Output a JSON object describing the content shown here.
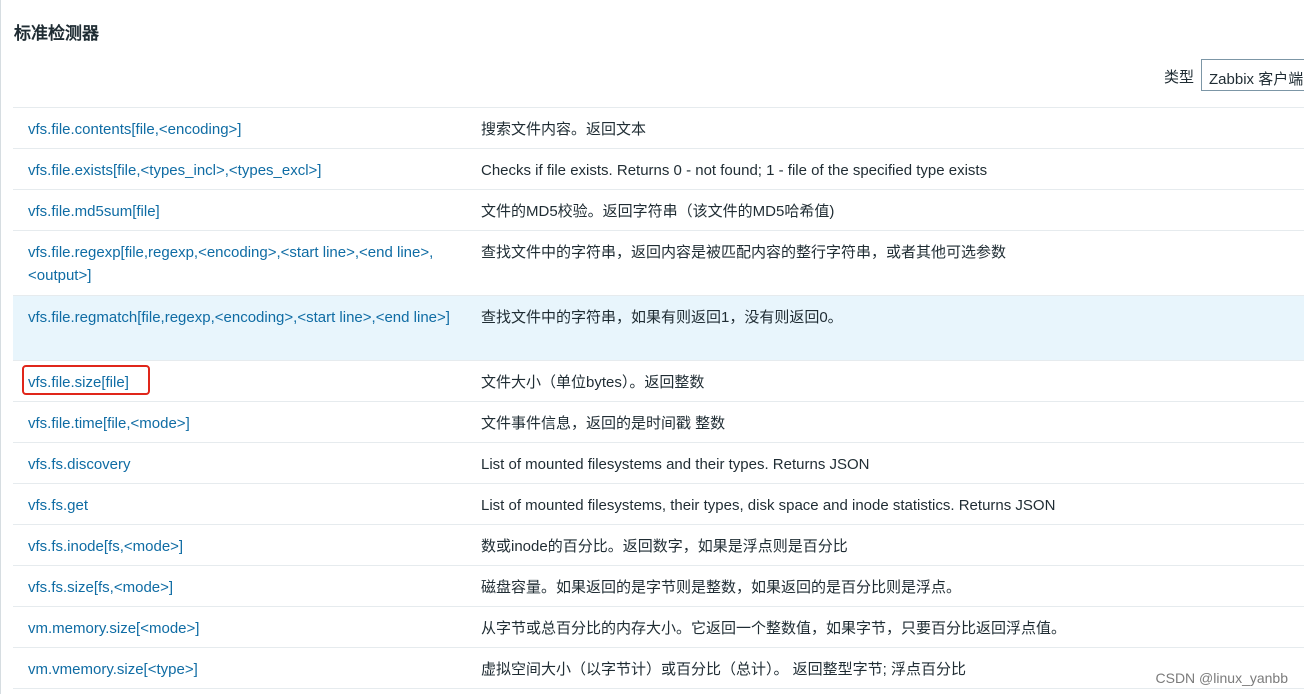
{
  "title": "标准检测器",
  "filter": {
    "type_label": "类型",
    "type_value": "Zabbix 客户端"
  },
  "rows": [
    {
      "key": "vfs.file.contents[file,<encoding>]",
      "desc": "搜索文件内容。返回文本"
    },
    {
      "key": "vfs.file.exists[file,<types_incl>,<types_excl>]",
      "desc": "Checks if file exists. Returns 0 - not found; 1 - file of the specified type exists"
    },
    {
      "key": "vfs.file.md5sum[file]",
      "desc": "文件的MD5校验。返回字符串（该文件的MD5哈希值)"
    },
    {
      "key": "vfs.file.regexp[file,regexp,<encoding>,<start line>,<end line>,<output>]",
      "desc": "查找文件中的字符串，返回内容是被匹配内容的整行字符串，或者其他可选参数"
    },
    {
      "key": "vfs.file.regmatch[file,regexp,<encoding>,<start line>,<end line>]",
      "desc": "查找文件中的字符串，如果有则返回1，没有则返回0。"
    },
    {
      "key": "vfs.file.size[file]",
      "desc": "文件大小（单位bytes）。返回整数"
    },
    {
      "key": "vfs.file.time[file,<mode>]",
      "desc": "文件事件信息，返回的是时间戳 整数"
    },
    {
      "key": "vfs.fs.discovery",
      "desc": "List of mounted filesystems and their types. Returns JSON"
    },
    {
      "key": "vfs.fs.get",
      "desc": "List of mounted filesystems, their types, disk space and inode statistics. Returns JSON"
    },
    {
      "key": "vfs.fs.inode[fs,<mode>]",
      "desc": "数或inode的百分比。返回数字，如果是浮点则是百分比"
    },
    {
      "key": "vfs.fs.size[fs,<mode>]",
      "desc": "磁盘容量。如果返回的是字节则是整数，如果返回的是百分比则是浮点。"
    },
    {
      "key": "vm.memory.size[<mode>]",
      "desc": "从字节或总百分比的内存大小。它返回一个整数值，如果字节，只要百分比返回浮点值。"
    },
    {
      "key": "vm.vmemory.size[<type>]",
      "desc": "虚拟空间大小（以字节计）或百分比（总计）。 返回整型字节; 浮点百分比"
    }
  ],
  "watermark": "CSDN @linux_yanbb"
}
